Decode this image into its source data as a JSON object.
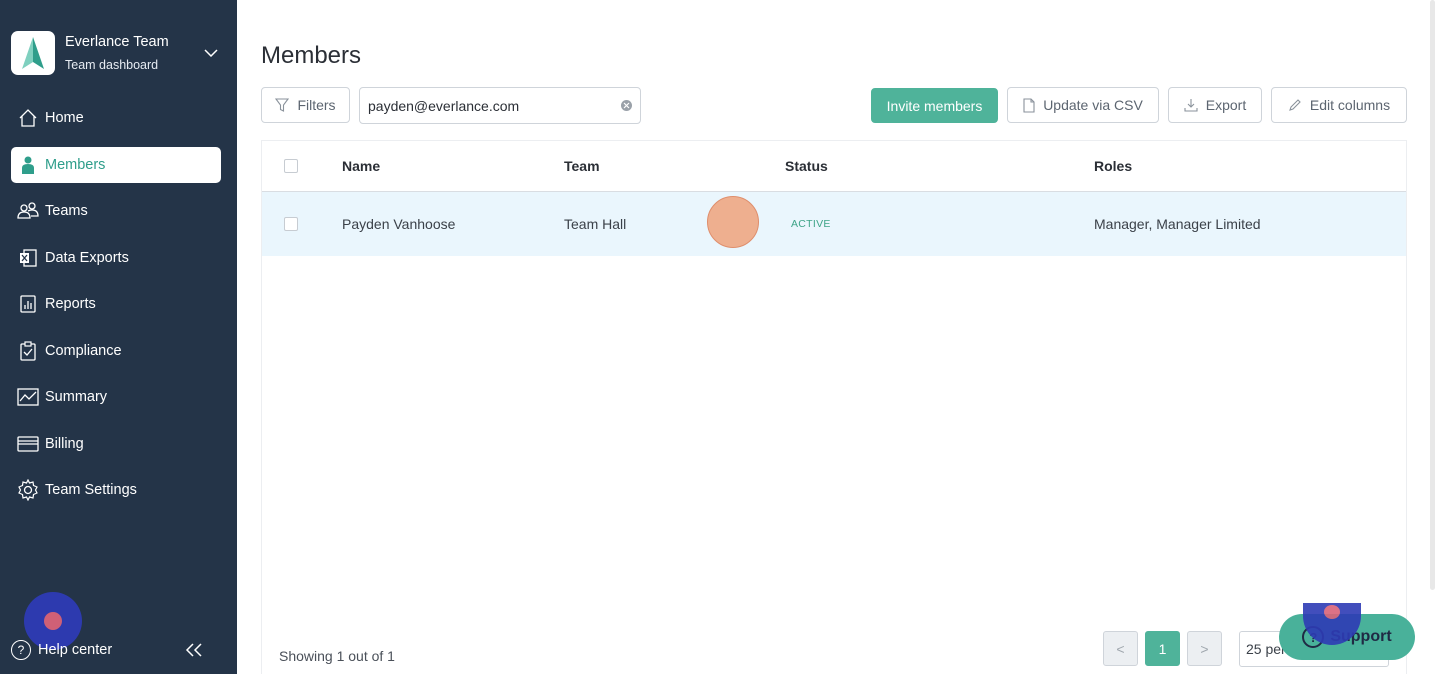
{
  "team": {
    "name": "Everlance Team",
    "subtitle": "Team dashboard"
  },
  "sidebar": {
    "items": [
      {
        "label": "Home",
        "icon": "home-icon"
      },
      {
        "label": "Members",
        "icon": "person-icon",
        "active": true
      },
      {
        "label": "Teams",
        "icon": "people-icon"
      },
      {
        "label": "Data Exports",
        "icon": "excel-icon"
      },
      {
        "label": "Reports",
        "icon": "report-icon"
      },
      {
        "label": "Compliance",
        "icon": "clipboard-check-icon"
      },
      {
        "label": "Summary",
        "icon": "line-chart-icon"
      },
      {
        "label": "Billing",
        "icon": "credit-card-icon"
      },
      {
        "label": "Team Settings",
        "icon": "gear-icon"
      }
    ],
    "help_label": "Help center"
  },
  "page": {
    "title": "Members"
  },
  "toolbar": {
    "filters_label": "Filters",
    "search_value": "payden@everlance.com",
    "invite_label": "Invite members",
    "update_csv_label": "Update via CSV",
    "export_label": "Export",
    "edit_columns_label": "Edit columns"
  },
  "table": {
    "columns": [
      "Name",
      "Team",
      "Status",
      "Roles"
    ],
    "rows": [
      {
        "name": "Payden Vanhoose",
        "team": "Team Hall",
        "status": "ACTIVE",
        "roles": "Manager, Manager Limited"
      }
    ]
  },
  "footer": {
    "showing": "Showing 1 out of 1",
    "prev": "<",
    "current_page": "1",
    "next": ">",
    "per_page": "25 per page"
  },
  "support": {
    "label": "Support"
  },
  "colors": {
    "sidebar": "#243448",
    "accent": "#4fb39a",
    "row_highlight": "#eaf6fd"
  }
}
